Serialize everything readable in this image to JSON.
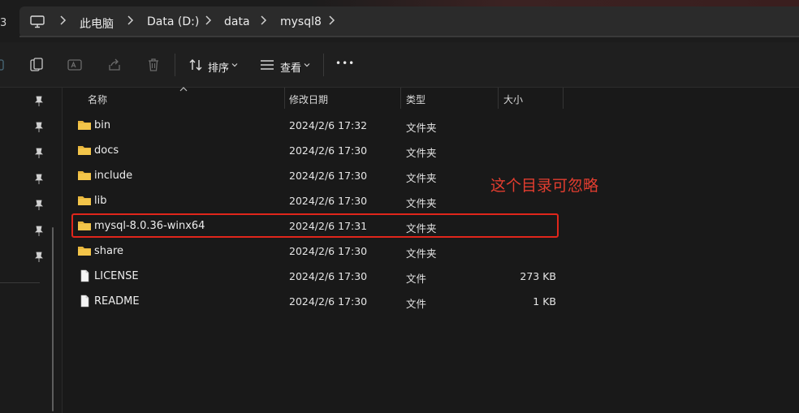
{
  "window": {
    "left_edge_glyph": "3"
  },
  "breadcrumb": {
    "items": [
      {
        "label": "此电脑"
      },
      {
        "label": "Data (D:)"
      },
      {
        "label": "data"
      },
      {
        "label": "mysql8"
      }
    ]
  },
  "toolbar": {
    "sort_label": "排序",
    "view_label": "查看",
    "more_label": "•••"
  },
  "columns": {
    "name": "名称",
    "modified": "修改日期",
    "type": "类型",
    "size": "大小"
  },
  "files": [
    {
      "name": "bin",
      "modified": "2024/2/6 17:32",
      "type": "文件夹",
      "size": "",
      "icon": "folder-icon"
    },
    {
      "name": "docs",
      "modified": "2024/2/6 17:30",
      "type": "文件夹",
      "size": "",
      "icon": "folder-icon"
    },
    {
      "name": "include",
      "modified": "2024/2/6 17:30",
      "type": "文件夹",
      "size": "",
      "icon": "folder-icon"
    },
    {
      "name": "lib",
      "modified": "2024/2/6 17:30",
      "type": "文件夹",
      "size": "",
      "icon": "folder-icon"
    },
    {
      "name": "mysql-8.0.36-winx64",
      "modified": "2024/2/6 17:31",
      "type": "文件夹",
      "size": "",
      "icon": "folder-icon"
    },
    {
      "name": "share",
      "modified": "2024/2/6 17:30",
      "type": "文件夹",
      "size": "",
      "icon": "folder-icon"
    },
    {
      "name": "LICENSE",
      "modified": "2024/2/6 17:30",
      "type": "文件",
      "size": "273 KB",
      "icon": "file-icon"
    },
    {
      "name": "README",
      "modified": "2024/2/6 17:30",
      "type": "文件",
      "size": "1 KB",
      "icon": "file-icon"
    }
  ],
  "annotation": {
    "text": "这个目录可忽略",
    "color": "#e23d2f"
  },
  "colors": {
    "folder": "#e8b63d",
    "highlight": "#e0261b",
    "background": "#191919"
  }
}
